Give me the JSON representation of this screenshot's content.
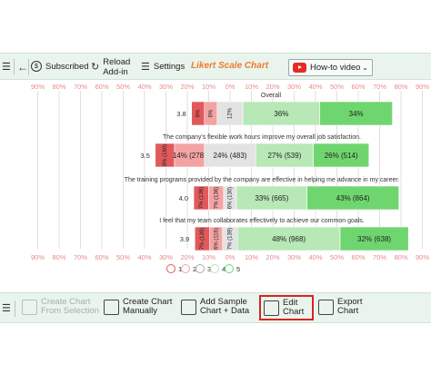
{
  "toolbar": {
    "subscribed_label": "Subscribed",
    "reload_label_1": "Reload",
    "reload_label_2": "Add-in",
    "settings_label": "Settings",
    "app_title": "Likert Scale Chart",
    "howto_label": "How-to video"
  },
  "bottombar": {
    "create_selection_1": "Create Chart",
    "create_selection_2": "From Selection",
    "create_manual_1": "Create Chart",
    "create_manual_2": "Manually",
    "add_sample_1": "Add Sample",
    "add_sample_2": "Chart + Data",
    "edit_1": "Edit",
    "edit_2": "Chart",
    "export_1": "Export",
    "export_2": "Chart"
  },
  "colors": {
    "c1": "#e2595b",
    "c2": "#f4a3a5",
    "c3": "#e3e3e3",
    "c4": "#b7e8b5",
    "c5": "#6fd66f",
    "axis_text": "#e88a8a",
    "accent": "#f07a2a",
    "highlight": "#d62424"
  },
  "chart_data": {
    "type": "bar",
    "subtype": "diverging-stacked",
    "axis_ticks": [
      "90%",
      "80%",
      "70%",
      "60%",
      "50%",
      "40%",
      "30%",
      "20%",
      "10%",
      "0%",
      "10%",
      "20%",
      "30%",
      "40%",
      "50%",
      "60%",
      "70%",
      "80%",
      "90%"
    ],
    "legend": [
      "1",
      "2",
      "3",
      "4",
      "5"
    ],
    "rows": [
      {
        "question": "Overall",
        "mean": "3.8",
        "values": [
          6,
          6,
          12,
          36,
          34
        ],
        "labels": [
          "6%",
          "6%",
          "12%",
          "36%",
          "34%"
        ]
      },
      {
        "question": "The company's flexible work hours improve my overall job satisfaction.",
        "mean": "3.5",
        "values": [
          9,
          14,
          24,
          27,
          26
        ],
        "labels": [
          "9% (180)",
          "14% (278)",
          "24% (483)",
          "27% (539)",
          "26% (514)"
        ]
      },
      {
        "question": "The training programs provided by the company are effective in helping me advance in my career.",
        "mean": "4.0",
        "values": [
          7,
          7,
          6,
          33,
          43
        ],
        "labels": [
          "7% (136)",
          "7% (136)",
          "6% (130)",
          "33% (665)",
          "43% (864)"
        ]
      },
      {
        "question": "I feel that my team collaborates effectively to achieve our common goals.",
        "mean": "3.9",
        "values": [
          7,
          6,
          7,
          48,
          32
        ],
        "labels": [
          "7% (139)",
          "6% (116)",
          "7% (139)",
          "48% (968)",
          "32% (638)"
        ]
      }
    ]
  }
}
